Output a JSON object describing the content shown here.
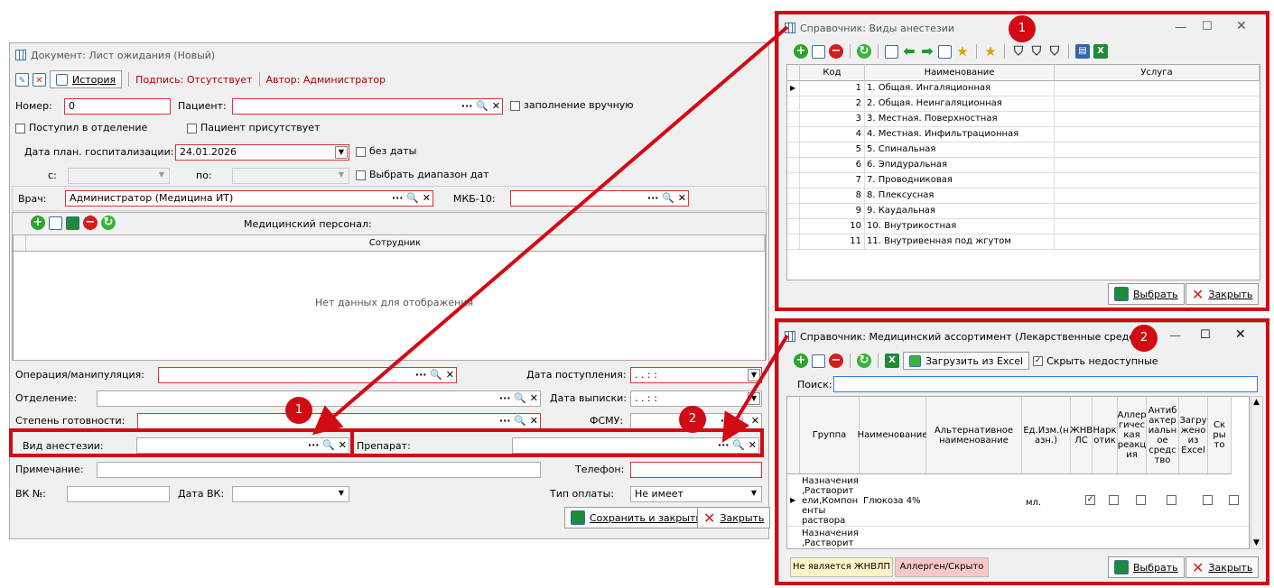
{
  "doc": {
    "title": "Документ: Лист ожидания (Новый)",
    "history_label": "История",
    "signature_label": "Подпись: Отсутствует",
    "author_label": "Автор: Администратор",
    "number_label": "Номер:",
    "number_value": "0",
    "patient_label": "Пациент:",
    "manual_fill_label": "заполнение вручную",
    "admitted_label": "Поступил в отделение",
    "patient_present_label": "Пациент присутствует",
    "plan_date_label": "Дата план. госпитализации:",
    "plan_date_value": "24.01.2026",
    "no_date_label": "без даты",
    "from_label": "с:",
    "to_label": "по:",
    "date_range_label": "Выбрать диапазон дат",
    "doctor_label": "Врач:",
    "doctor_value": "Администратор (Медицина ИТ)",
    "mkb_label": "МКБ-10:",
    "staff_label": "Медицинский персонал:",
    "employee_col": "Сотрудник",
    "no_data": "Нет данных для отображения",
    "operation_label": "Операция/манипуляция:",
    "admission_date_label": "Дата поступления:",
    "department_label": "Отделение:",
    "discharge_date_label": "Дата выписки:",
    "readiness_label": "Степень готовности:",
    "fsmu_label": "ФСМУ:",
    "anesthesia_label": "Вид анестезии:",
    "drug_label": "Препарат:",
    "note_label": "Примечание:",
    "phone_label": "Телефон:",
    "vk_no_label": "ВК №:",
    "vk_date_label": "Дата ВК:",
    "payment_type_label": "Тип оплаты:",
    "payment_type_value": "Не имеет",
    "save_close_label": "Сохранить и закрыть",
    "close_label": "Закрыть",
    "date_placeholder": ". .   : :",
    "lookup_buttons": "··· 🔍 ✕"
  },
  "anesthesia_dict": {
    "title": "Справочник: Виды анестезии",
    "columns": {
      "code": "Код",
      "name": "Наименование",
      "service": "Услуга"
    },
    "rows": [
      {
        "code": "1",
        "name": "1. Общая. Ингаляционная"
      },
      {
        "code": "2",
        "name": "2. Общая. Неингаляционная"
      },
      {
        "code": "3",
        "name": "3. Местная. Поверхностная"
      },
      {
        "code": "4",
        "name": "4. Местная. Инфильтрационная"
      },
      {
        "code": "5",
        "name": "5. Спинальная"
      },
      {
        "code": "6",
        "name": "6. Эпидуральная"
      },
      {
        "code": "7",
        "name": "7. Проводниковая"
      },
      {
        "code": "8",
        "name": "8. Плексусная"
      },
      {
        "code": "9",
        "name": "9. Каудальная"
      },
      {
        "code": "10",
        "name": "10. Внутрикостная"
      },
      {
        "code": "11",
        "name": "11. Внутривенная под жгутом"
      }
    ],
    "select_label": "Выбрать",
    "close_label": "Закрыть"
  },
  "assortment_dict": {
    "title": "Справочник: Медицинский ассортимент (Лекарственные средства)",
    "load_excel_label": "Загрузить из Excel",
    "hide_unavailable_label": "Скрыть недоступные",
    "search_label": "Поиск:",
    "columns": [
      "Группа",
      "Наименование",
      "Альтернативное наименование",
      "Ед.Изм.(н азн.)",
      "ЖНВ ЛС",
      "Нарк отик",
      "Аллер гичес кая реакц ия",
      "Антиб актер иальн ое средс тво",
      "Загру жено из Excel",
      "Ск ры то"
    ],
    "row1": {
      "group": "Назначения ,Растворит ели,Компон енты раствора",
      "name": "Глюкоза 4%",
      "unit": "мл."
    },
    "row2_group": "Назначения ,Растворит",
    "legend_not_vital": "Не является ЖНВЛП",
    "legend_allergen": "Аллерген/Скрыто",
    "select_label": "Выбрать",
    "close_label": "Закрыть"
  },
  "badges": {
    "one": "1",
    "two": "2"
  },
  "colors": {
    "accent_red": "#d20a14",
    "row_highlight": "#fff0cc",
    "legend_pink": "#f8c8c8",
    "legend_yellow": "#fff5c8"
  }
}
